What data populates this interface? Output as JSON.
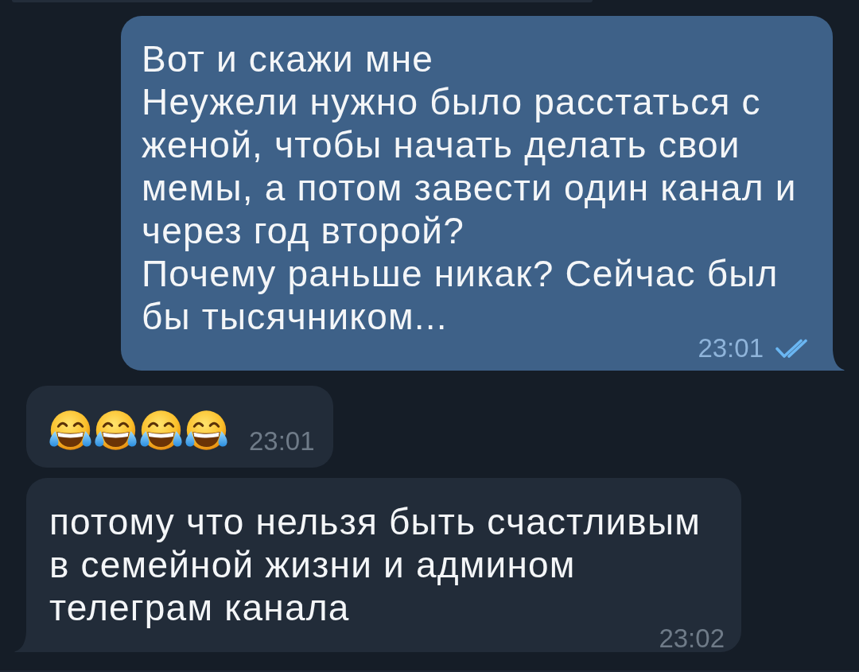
{
  "messages": [
    {
      "kind": "text",
      "outgoing": true,
      "tail": true,
      "text": "Вот и скажи мне\nНеужели нужно было расстаться с женой, чтобы начать делать свои мемы, а потом завести один канал и через год второй?\nПочему раньше никак? Сейчас был бы тысячником...",
      "time": "23:01",
      "read": true
    },
    {
      "kind": "emoji",
      "outgoing": false,
      "tail": false,
      "emojis": [
        {
          "kind": "tears_of_joy"
        },
        {
          "kind": "tears_of_joy"
        },
        {
          "kind": "tears_of_joy"
        },
        {
          "kind": "tears_of_joy"
        }
      ],
      "time": "23:01"
    },
    {
      "kind": "text",
      "outgoing": false,
      "tail": true,
      "text": "потому что нельзя быть счастливым в семейной жизни и админом телеграм канала",
      "time": "23:02"
    }
  ]
}
